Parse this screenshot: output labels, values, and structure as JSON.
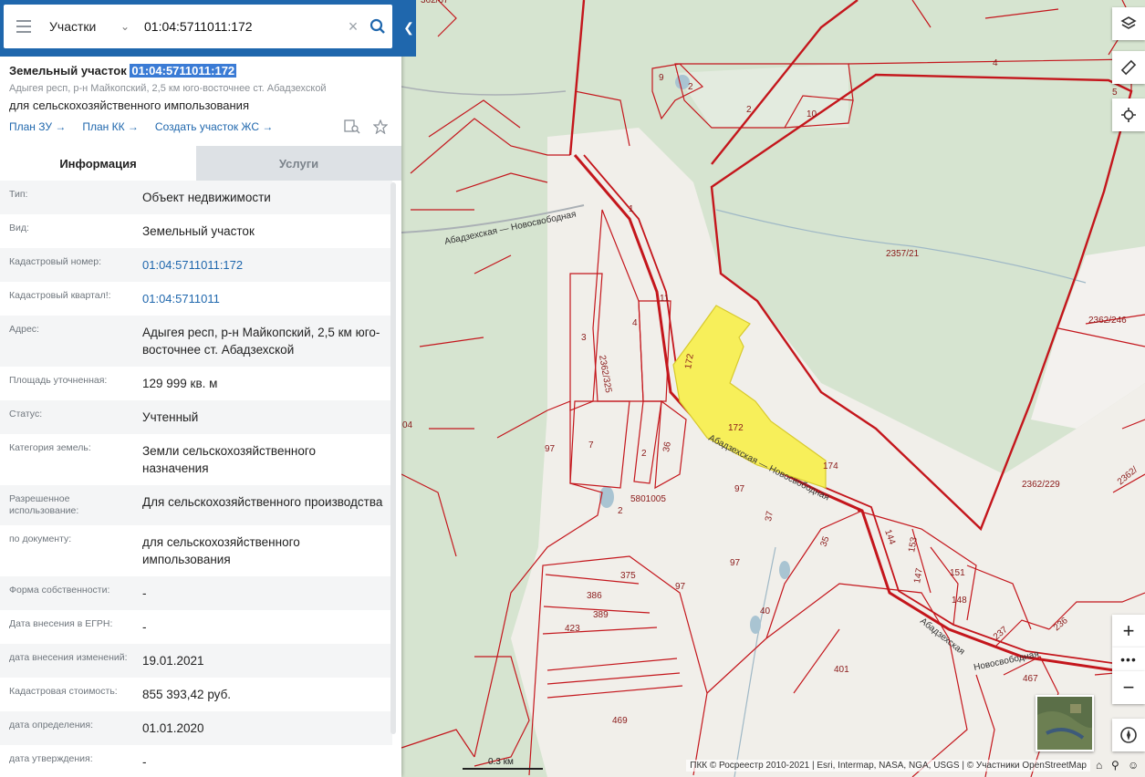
{
  "search": {
    "category": "Участки",
    "query": "01:04:5711011:172"
  },
  "object": {
    "title_prefix": "Земельный участок",
    "title_number": "01:04:5711011:172",
    "address": "Адыгея респ, р-н Майкопский, 2,5 км юго-восточнее ст. Абадзехской",
    "use": "для сельскохозяйственного импользования",
    "links": [
      "План ЗУ →",
      "План КК →",
      "Создать участок ЖС →"
    ]
  },
  "tabs": [
    "Информация",
    "Услуги"
  ],
  "rows": [
    {
      "k": "Тип:",
      "v": "Объект недвижимости"
    },
    {
      "k": "Вид:",
      "v": "Земельный участок"
    },
    {
      "k": "Кадастровый номер:",
      "v": "01:04:5711011:172",
      "link": true
    },
    {
      "k": "Кадастровый квартал!:",
      "v": "01:04:5711011",
      "link": true
    },
    {
      "k": "Адрес:",
      "v": "Адыгея респ, р-н Майкопский, 2,5 км юго-восточнее ст. Абадзехской"
    },
    {
      "k": "Площадь уточненная:",
      "v": "129 999 кв. м"
    },
    {
      "k": "Статус:",
      "v": "Учтенный"
    },
    {
      "k": "Категория земель:",
      "v": "Земли сельскохозяйственного назначения"
    },
    {
      "k": "Разрешенное использование:",
      "v": "Для сельскохозяйственного производства"
    },
    {
      "k": "по документу:",
      "v": "для сельскохозяйственного импользования"
    },
    {
      "k": "Форма собственности:",
      "v": "-"
    },
    {
      "k": "Дата внесения в ЕГРН:",
      "v": "-"
    },
    {
      "k": "дата внесения изменений:",
      "v": "19.01.2021"
    },
    {
      "k": "Кадастровая стоимость:",
      "v": "855 393,42 руб."
    },
    {
      "k": "дата определения:",
      "v": "01.01.2020"
    },
    {
      "k": "дата утверждения:",
      "v": "-"
    }
  ],
  "map": {
    "parcel_labels": [
      "9",
      "2",
      "2",
      "10",
      "4",
      "5",
      "1",
      "2357/21",
      "11",
      "4",
      "3",
      "2362/325",
      "2362/246",
      "172",
      "172",
      "174",
      "97",
      "7",
      "2",
      "36",
      "5801005",
      "2",
      "97",
      "37",
      "35",
      "144",
      "153",
      "151",
      "97",
      "147",
      "148",
      "386",
      "375",
      "389",
      "423",
      "40",
      "97",
      "401",
      "237",
      "236",
      "467",
      "469",
      "2362/229",
      "2362/",
      "04",
      "362/67"
    ],
    "road_labels": [
      "Абадзехская — Новосвободная",
      "Абадзехская — Новосвободная",
      "Абадзехская — Новосвободная"
    ],
    "scale": "0.3 км",
    "attribution": "ПКК © Росреестр 2010-2021 | Esri, Intermap, NASA, NGA, USGS | © Участники OpenStreetMap"
  },
  "colors": {
    "header": "#1f67ad",
    "parcel_border": "#c4161c",
    "selected_fill": "#f7ef5a",
    "forest": "#cfe0c8",
    "open_land": "#f5f3f0"
  }
}
